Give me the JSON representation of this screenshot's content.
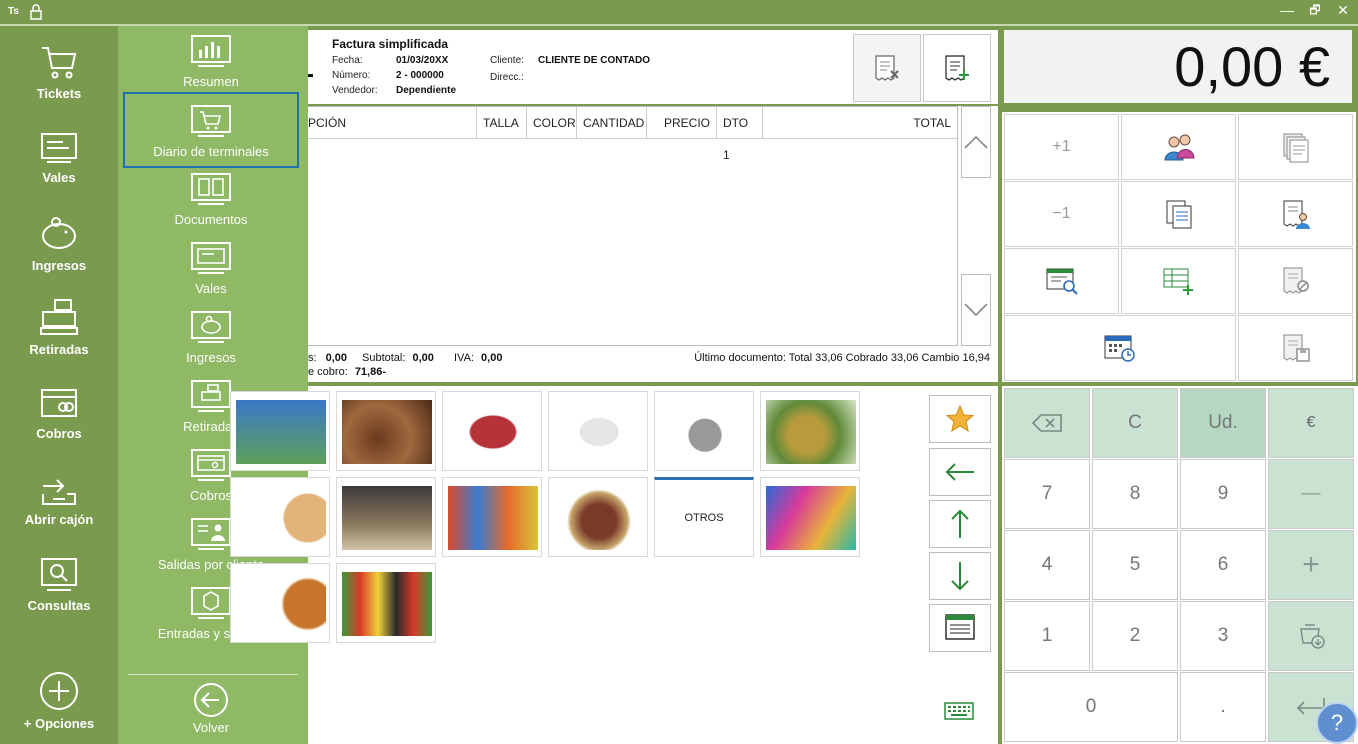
{
  "titlebar": {
    "user_initials": "Ts",
    "minimize": "—",
    "restore": "🗗",
    "close": "✕"
  },
  "rail": [
    {
      "label": "Tickets",
      "icon": "cart-icon"
    },
    {
      "label": "Vales",
      "icon": "voucher-icon"
    },
    {
      "label": "Ingresos",
      "icon": "piggy-bank-icon"
    },
    {
      "label": "Retiradas",
      "icon": "cash-register-icon"
    },
    {
      "label": "Cobros",
      "icon": "card-icon"
    },
    {
      "label": "Abrir cajón",
      "icon": "open-drawer-icon"
    },
    {
      "label": "Consultas",
      "icon": "search-icon"
    },
    {
      "label": "+ Opciones",
      "icon": "plus-circle-icon"
    }
  ],
  "submenu": [
    {
      "label": "Resumen",
      "icon": "bar-chart-icon"
    },
    {
      "label": "Diario de terminales",
      "icon": "cart-icon"
    },
    {
      "label": "Documentos",
      "icon": "documents-icon"
    },
    {
      "label": "Vales",
      "icon": "voucher-icon"
    },
    {
      "label": "Ingresos",
      "icon": "piggy-bank-icon"
    },
    {
      "label": "Retiradas",
      "icon": "cash-register-icon"
    },
    {
      "label": "Cobros",
      "icon": "card-icon"
    },
    {
      "label": "Salidas por cliente",
      "icon": "client-icon"
    },
    {
      "label": "Entradas y salidas",
      "icon": "box-icon"
    }
  ],
  "submenu_back": "Volver",
  "document": {
    "title": "Factura simplificada",
    "fecha_label": "Fecha:",
    "fecha": "01/03/20XX",
    "numero_label": "Número:",
    "numero": "2 - 000000",
    "vendedor_label": "Vendedor:",
    "vendedor": "Dependiente",
    "cliente_label": "Cliente:",
    "cliente": "CLIENTE DE CONTADO",
    "direcc_label": "Direcc.:"
  },
  "grid_columns": [
    "PCIÓN",
    "TALLA",
    "COLOR",
    "CANTIDAD",
    "PRECIO",
    "DTO 1",
    "TOTAL"
  ],
  "totals": {
    "s_label": "s:",
    "s_value": "0,00",
    "subtotal_label": "Subtotal:",
    "subtotal": "0,00",
    "iva_label": "IVA:",
    "iva": "0,00",
    "cobro_label": "e cobro:",
    "cobro": "71,86-",
    "last_doc": "Último documento: Total 33,06 Cobrado 33,06 Cambio 16,94"
  },
  "products": {
    "otros": "OTROS"
  },
  "amount": "0,00 €",
  "func": {
    "plus_one": "+1",
    "minus_one": "−1"
  },
  "keypad": {
    "clear": "C",
    "units": "Ud.",
    "euro": "€",
    "k7": "7",
    "k8": "8",
    "k9": "9",
    "minus": "—",
    "k4": "4",
    "k5": "5",
    "k6": "6",
    "plus": "+",
    "k1": "1",
    "k2": "2",
    "k3": "3",
    "k0": "0",
    "dot": "."
  },
  "help": "?"
}
